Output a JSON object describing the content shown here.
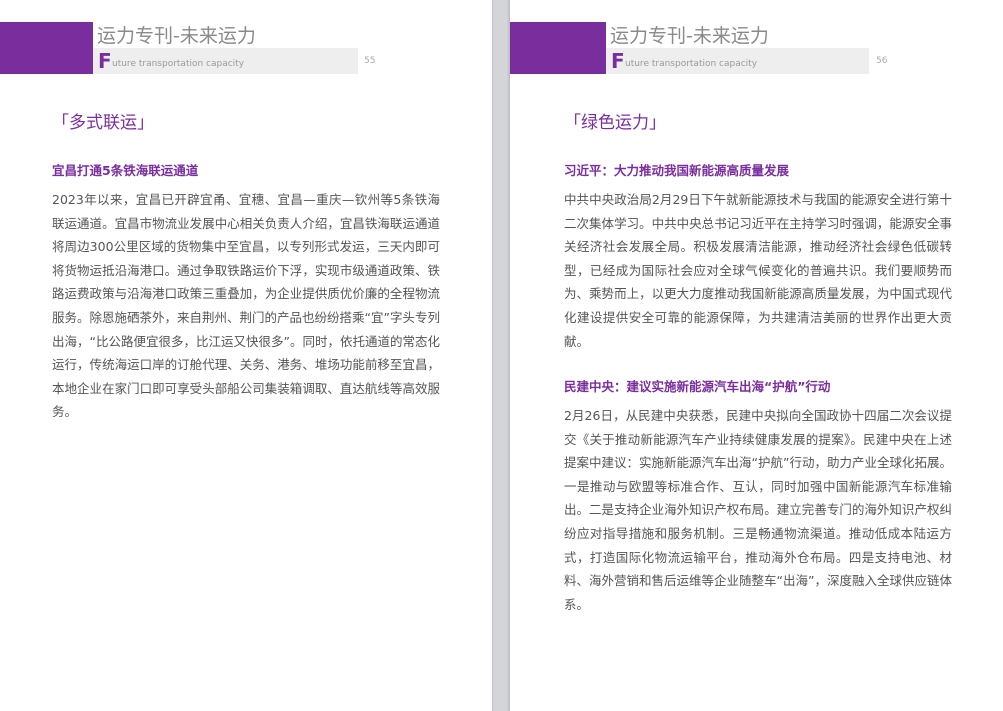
{
  "left_page": {
    "magazine_title": "运力专刊-未来运力",
    "subtitle_initial": "F",
    "subtitle_rest": "uture transportation capacity",
    "page_number": "55",
    "section": "「多式联运」",
    "articles": [
      {
        "title": "宜昌打通5条铁海联运通道",
        "body": "2023年以来，宜昌已开辟宜甬、宜穗、宜昌—重庆—钦州等5条铁海联运通道。宜昌市物流业发展中心相关负责人介绍，宜昌铁海联运通道将周边300公里区域的货物集中至宜昌，以专列形式发运，三天内即可将货物运抵沿海港口。通过争取铁路运价下浮，实现市级通道政策、铁路运费政策与沿海港口政策三重叠加，为企业提供质优价廉的全程物流服务。除恩施硒茶外，来自荆州、荆门的产品也纷纷搭乘“宜”字头专列出海，“比公路便宜很多，比江运又快很多”。同时，依托通道的常态化运行，传统海运口岸的订舱代理、关务、港务、堆场功能前移至宜昌，本地企业在家门口即可享受头部船公司集装箱调取、直达航线等高效服务。"
      }
    ]
  },
  "right_page": {
    "magazine_title": "运力专刊-未来运力",
    "subtitle_initial": "F",
    "subtitle_rest": "uture transportation capacity",
    "page_number": "56",
    "section": "「绿色运力」",
    "articles": [
      {
        "title": "习近平：大力推动我国新能源高质量发展",
        "body": "中共中央政治局2月29日下午就新能源技术与我国的能源安全进行第十二次集体学习。中共中央总书记习近平在主持学习时强调，能源安全事关经济社会发展全局。积极发展清洁能源，推动经济社会绿色低碳转型，已经成为国际社会应对全球气候变化的普遍共识。我们要顺势而为、乘势而上，以更大力度推动我国新能源高质量发展，为中国式现代化建设提供安全可靠的能源保障，为共建清洁美丽的世界作出更大贡献。"
      },
      {
        "title": "民建中央：建议实施新能源汽车出海“护航”行动",
        "body": "2月26日，从民建中央获悉，民建中央拟向全国政协十四届二次会议提交《关于推动新能源汽车产业持续健康发展的提案》。民建中央在上述提案中建议：实施新能源汽车出海“护航”行动，助力产业全球化拓展。一是推动与欧盟等标准合作、互认，同时加强中国新能源汽车标准输出。二是支持企业海外知识产权布局。建立完善专门的海外知识产权纠纷应对指导措施和服务机制。三是畅通物流渠道。推动低成本陆运方式，打造国际化物流运输平台，推动海外仓布局。四是支持电池、材料、海外营销和售后运维等企业随整车“出海”，深度融入全球供应链体系。"
      }
    ]
  },
  "colors": {
    "accent_purple": "#7a2e9e",
    "body_text": "#555555",
    "header_gray": "#8a8a8a",
    "subbar_bg": "#eeeeee"
  }
}
